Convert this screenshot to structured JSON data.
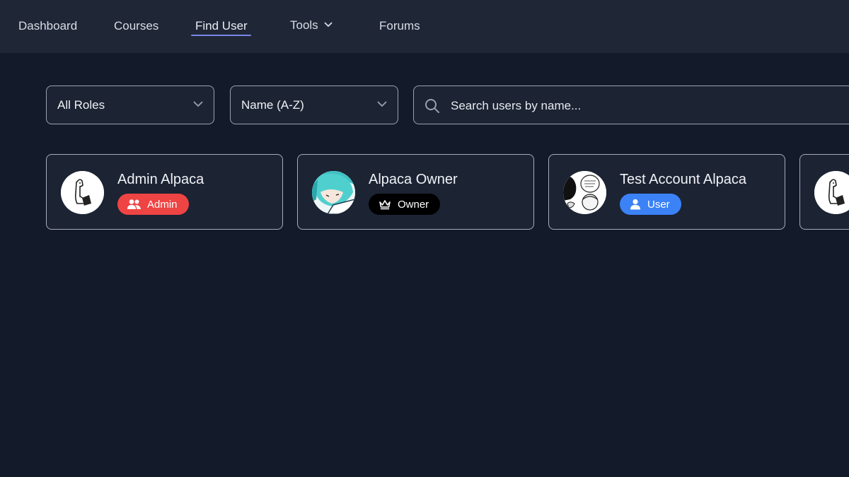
{
  "nav": {
    "items": [
      {
        "label": "Dashboard"
      },
      {
        "label": "Courses"
      },
      {
        "label": "Find User"
      },
      {
        "label": "Tools"
      },
      {
        "label": "Forums"
      }
    ],
    "active": "Find User",
    "accent_color": "#7b86e8"
  },
  "filters": {
    "role_select": {
      "value": "All Roles",
      "icon": "chevron-down-icon"
    },
    "sort_select": {
      "value": "Name (A-Z)",
      "icon": "chevron-down-icon"
    },
    "search": {
      "placeholder": "Search users by name...",
      "value": "",
      "icon": "search-icon"
    }
  },
  "users": [
    {
      "name": "Admin Alpaca",
      "role": "Admin",
      "role_icon": "users-icon",
      "role_color": "#ef4444"
    },
    {
      "name": "Alpaca Owner",
      "role": "Owner",
      "role_icon": "crown-icon",
      "role_color": "#000000"
    },
    {
      "name": "Test Account Alpaca",
      "role": "User",
      "role_icon": "user-icon",
      "role_color": "#3b82f6"
    }
  ],
  "colors": {
    "background": "#131a2a",
    "navbar": "#1f2737",
    "card": "#1c2333"
  }
}
